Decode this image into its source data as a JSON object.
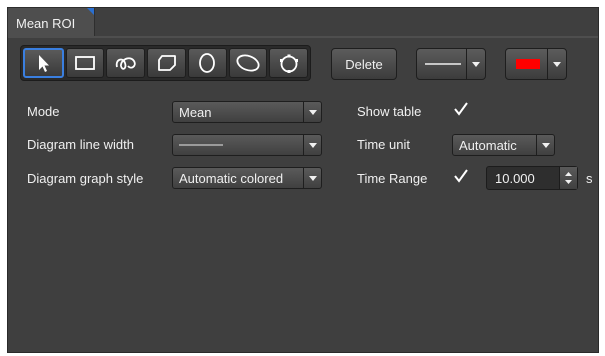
{
  "tab": {
    "title": "Mean ROI"
  },
  "toolbar": {
    "tools": [
      {
        "name": "pointer-tool",
        "icon": "arrow-pointer-icon",
        "active": true
      },
      {
        "name": "rectangle-tool",
        "icon": "rectangle-icon"
      },
      {
        "name": "freehand-tool",
        "icon": "freehand-curve-icon"
      },
      {
        "name": "polygon-tool",
        "icon": "polygon-icon"
      },
      {
        "name": "circle-tool",
        "icon": "circle-icon"
      },
      {
        "name": "ellipse-tool",
        "icon": "ellipse-icon"
      },
      {
        "name": "spline-tool",
        "icon": "closed-spline-icon"
      }
    ],
    "delete_label": "Delete",
    "line_style_icon": "line-style-icon",
    "line_color": "#ff0000"
  },
  "settings": {
    "mode": {
      "label": "Mode",
      "value": "Mean"
    },
    "line_width": {
      "label": "Diagram line width",
      "value_icon": "thin-line-icon"
    },
    "graph_style": {
      "label": "Diagram graph style",
      "value": "Automatic colored"
    },
    "show_table": {
      "label": "Show table",
      "checked": true
    },
    "time_unit": {
      "label": "Time unit",
      "value": "Automatic"
    },
    "time_range": {
      "label": "Time Range",
      "checked": true,
      "value": "10.000",
      "unit": "s"
    }
  }
}
